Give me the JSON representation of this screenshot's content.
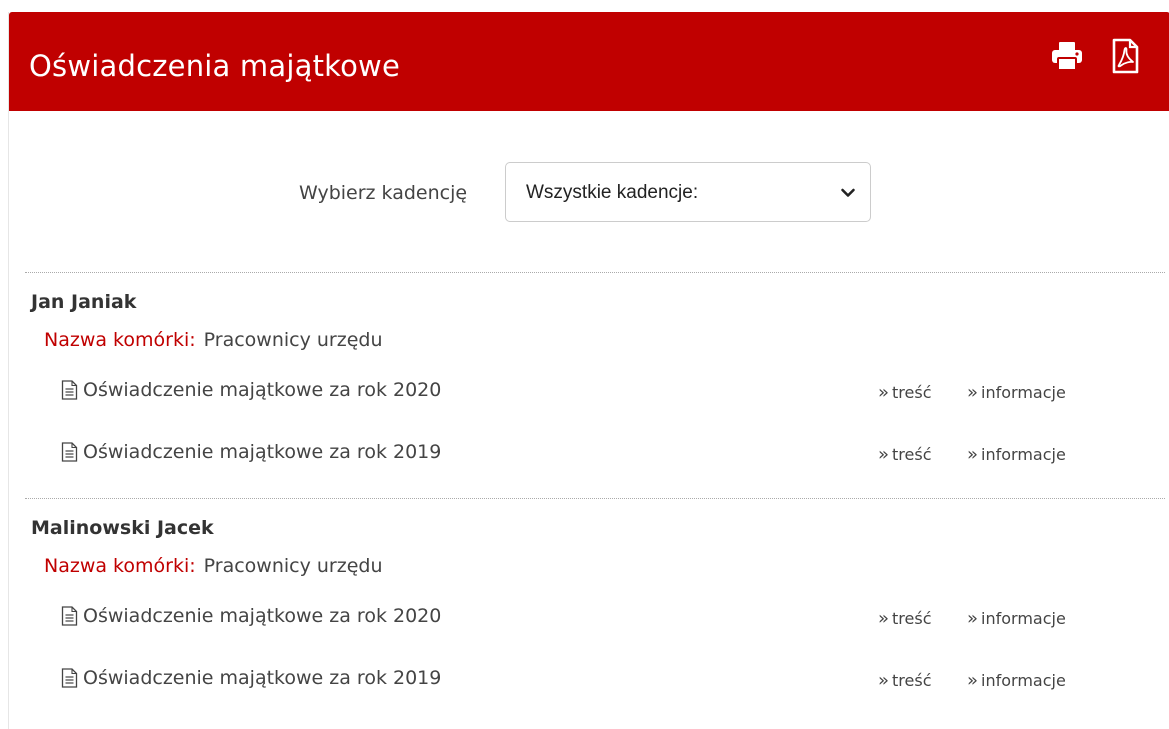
{
  "header": {
    "title": "Oświadczenia majątkowe",
    "bg_color": "#c00000",
    "print_icon": "print-icon",
    "pdf_icon": "pdf-icon"
  },
  "filter": {
    "label": "Wybierz kadencję",
    "selected": "Wszystkie kadencje:"
  },
  "people": [
    {
      "name": "Jan Janiak",
      "unit_label": "Nazwa komórki:",
      "unit_value": "Pracownicy urzędu",
      "documents": [
        {
          "title": "Oświadczenie majątkowe za rok 2020",
          "action1": "treść",
          "action2": "informacje"
        },
        {
          "title": "Oświadczenie majątkowe za rok 2019",
          "action1": "treść",
          "action2": "informacje"
        }
      ]
    },
    {
      "name": "Malinowski Jacek",
      "unit_label": "Nazwa komórki:",
      "unit_value": "Pracownicy urzędu",
      "documents": [
        {
          "title": "Oświadczenie majątkowe za rok 2020",
          "action1": "treść",
          "action2": "informacje"
        },
        {
          "title": "Oświadczenie majątkowe za rok 2019",
          "action1": "treść",
          "action2": "informacje"
        }
      ]
    }
  ],
  "accent_color": "#c00000"
}
